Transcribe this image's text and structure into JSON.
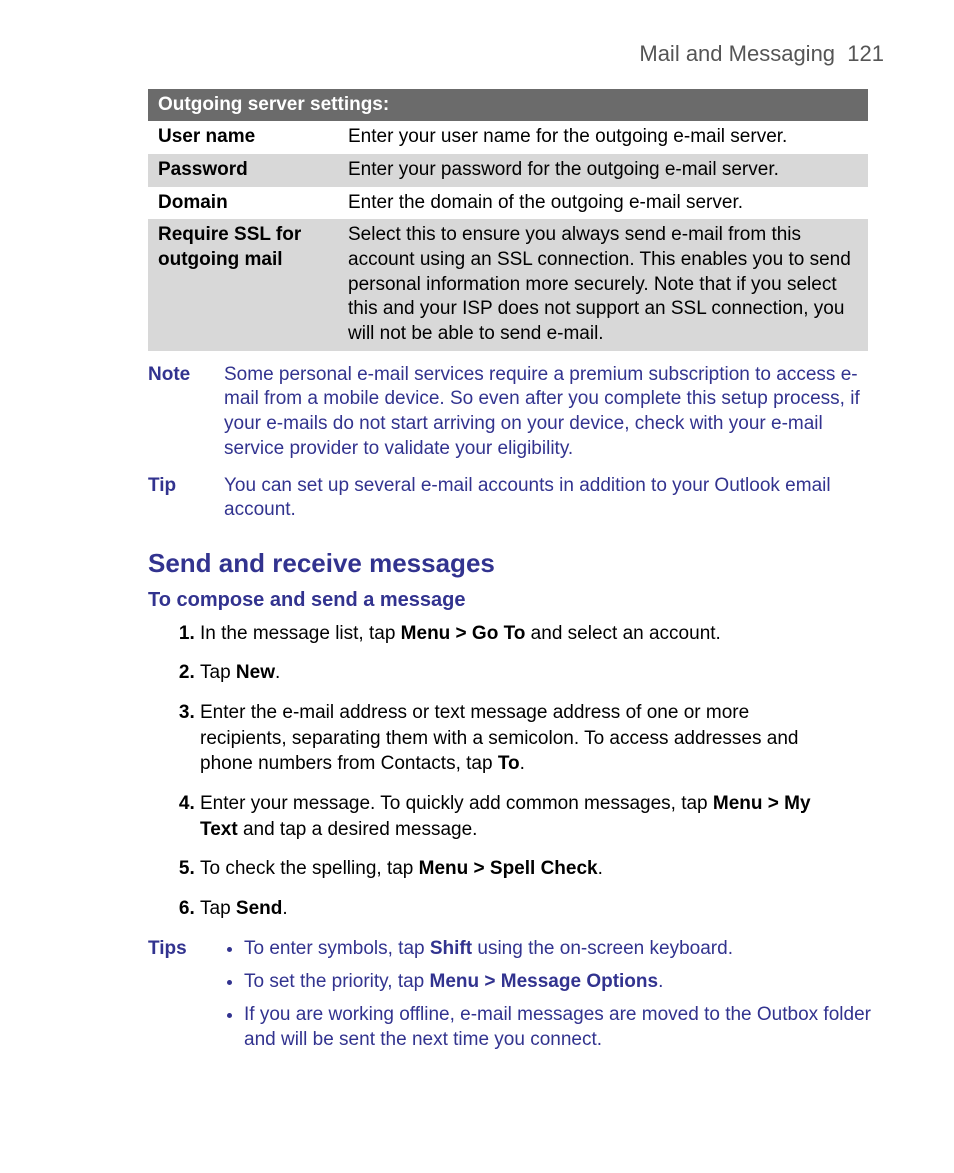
{
  "header": {
    "section": "Mail and Messaging",
    "page": "121"
  },
  "table": {
    "section_header": "Outgoing server settings:",
    "rows": [
      {
        "label": "User name",
        "desc": "Enter your user name for the outgoing e-mail server."
      },
      {
        "label": "Password",
        "desc": "Enter your password for the outgoing e-mail server."
      },
      {
        "label": "Domain",
        "desc": "Enter the domain of the outgoing e-mail server."
      },
      {
        "label": "Require SSL for outgoing mail",
        "desc": "Select this to ensure you always send e-mail from this account using an SSL connection. This enables you to send personal information more securely. Note that if you select this and your ISP does not support an SSL connection, you will not be able to send e-mail."
      }
    ]
  },
  "note": {
    "label": "Note",
    "text": "Some personal e-mail services require a premium subscription to access e-mail from a mobile device. So even after you complete this setup process, if your e-mails do not start arriving on your device, check with your e-mail service provider to validate your eligibility."
  },
  "tip": {
    "label": "Tip",
    "text": "You can set up several e-mail accounts in addition to your Outlook email account."
  },
  "heading": "Send and receive messages",
  "subheading": "To compose and send a message",
  "steps": {
    "s1_a": "In the message list, tap ",
    "s1_b": "Menu > Go To",
    "s1_c": " and select an account.",
    "s2_a": "Tap ",
    "s2_b": "New",
    "s2_c": ".",
    "s3_a": "Enter the e-mail address or text message address of one or more recipients, separating them with a semicolon. To access addresses and phone numbers from Contacts, tap ",
    "s3_b": "To",
    "s3_c": ".",
    "s4_a": "Enter your message. To quickly add common messages, tap ",
    "s4_b": "Menu > My Text",
    "s4_c": " and tap a desired message.",
    "s5_a": "To check the spelling, tap ",
    "s5_b": "Menu > Spell Check",
    "s5_c": ".",
    "s6_a": "Tap ",
    "s6_b": "Send",
    "s6_c": "."
  },
  "tips": {
    "label": "Tips",
    "t1_a": "To enter symbols, tap ",
    "t1_b": "Shift",
    "t1_c": " using the on-screen keyboard.",
    "t2_a": "To set the priority, tap ",
    "t2_b": "Menu > Message Options",
    "t2_c": ".",
    "t3": "If you are working offline, e-mail messages are moved to the Outbox folder and will be sent the next time you connect."
  }
}
